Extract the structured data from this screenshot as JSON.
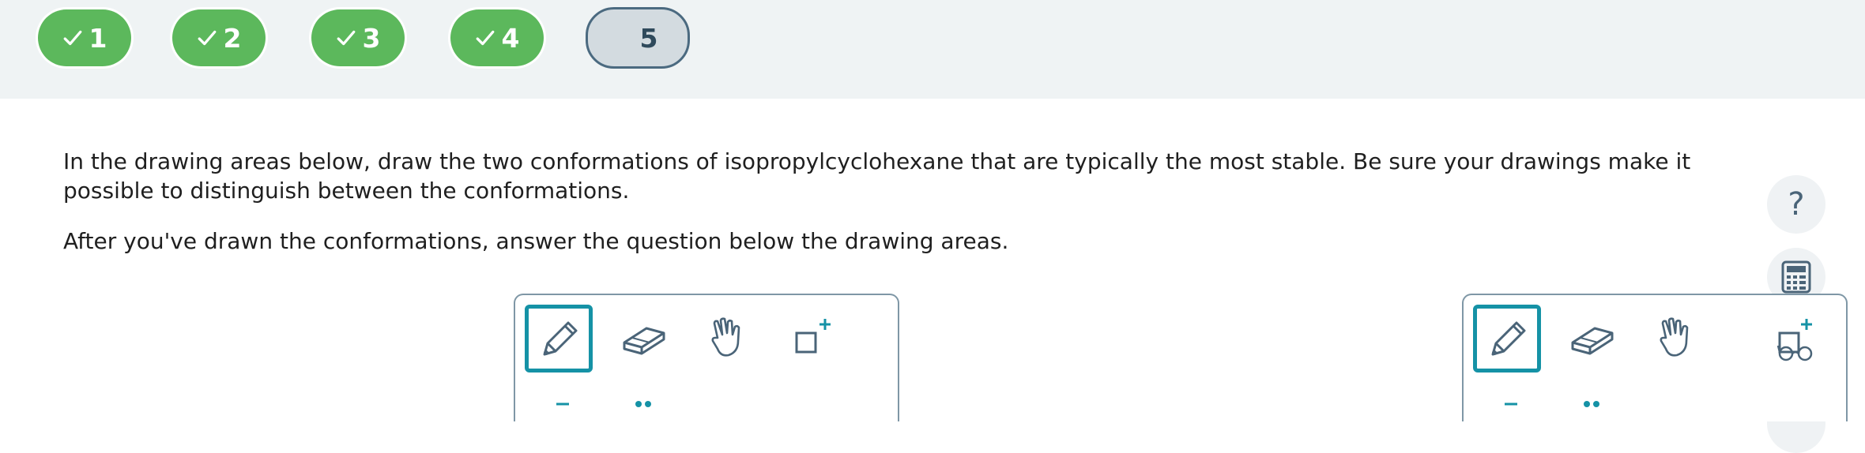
{
  "progress": {
    "steps": [
      {
        "label": "1",
        "status": "complete"
      },
      {
        "label": "2",
        "status": "complete"
      },
      {
        "label": "3",
        "status": "complete"
      },
      {
        "label": "4",
        "status": "complete"
      },
      {
        "label": "5",
        "status": "current"
      }
    ]
  },
  "question": {
    "paragraph1": "In the drawing areas below, draw the two conformations of isopropylcyclohexane that are typically the most stable. Be sure your drawings make it possible to distinguish between the conformations.",
    "paragraph2": "After you've drawn the conformations, answer the question below the drawing areas."
  },
  "rail": {
    "help_glyph": "?",
    "icons": [
      "help-icon",
      "calculator-icon",
      "partial-circle-icon"
    ]
  },
  "drawing_panels": [
    {
      "tools": [
        "pencil-icon",
        "eraser-icon",
        "hand-icon",
        "add-box-icon"
      ],
      "selected": "pencil-icon"
    },
    {
      "tools": [
        "pencil-icon",
        "eraser-icon",
        "hand-icon",
        "add-box-icon"
      ],
      "selected": "pencil-icon"
    }
  ],
  "colors": {
    "complete": "#5cb85c",
    "current_bg": "#d3dbe0",
    "current_border": "#4b6a80",
    "accent": "#1592a6",
    "icon": "#4a6478"
  }
}
